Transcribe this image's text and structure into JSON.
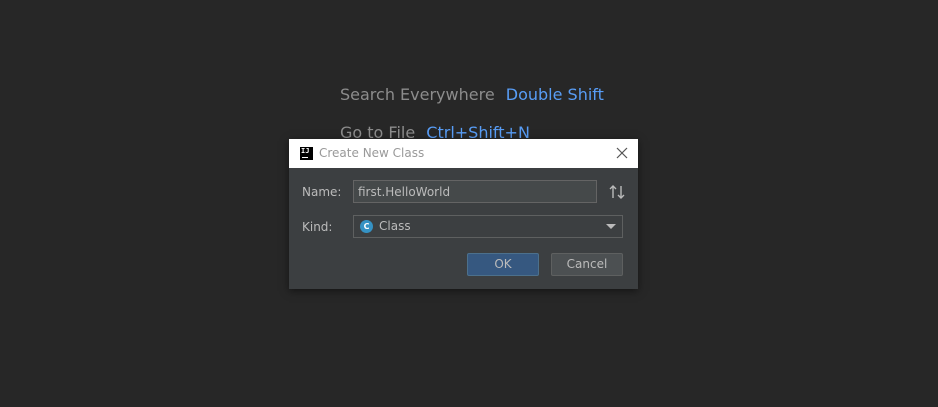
{
  "hints": {
    "search_label": "Search Everywhere",
    "search_shortcut": "Double Shift",
    "goto_label": "Go to File",
    "goto_shortcut": "Ctrl+Shift+N"
  },
  "dialog": {
    "title": "Create New Class",
    "app_icon_text": "IJ",
    "name_label": "Name:",
    "name_value": "first.HelloWorld",
    "kind_label": "Kind:",
    "kind_icon_letter": "C",
    "kind_value": "Class",
    "ok_label": "OK",
    "cancel_label": "Cancel"
  },
  "colors": {
    "background": "#272727",
    "dialog_bg": "#3c3f41",
    "accent_link": "#589df6",
    "ok_button": "#365880",
    "class_icon": "#3592c4"
  },
  "icons": {
    "close": "close-icon",
    "sort": "sort-arrows-icon",
    "dropdown": "chevron-down-icon"
  }
}
